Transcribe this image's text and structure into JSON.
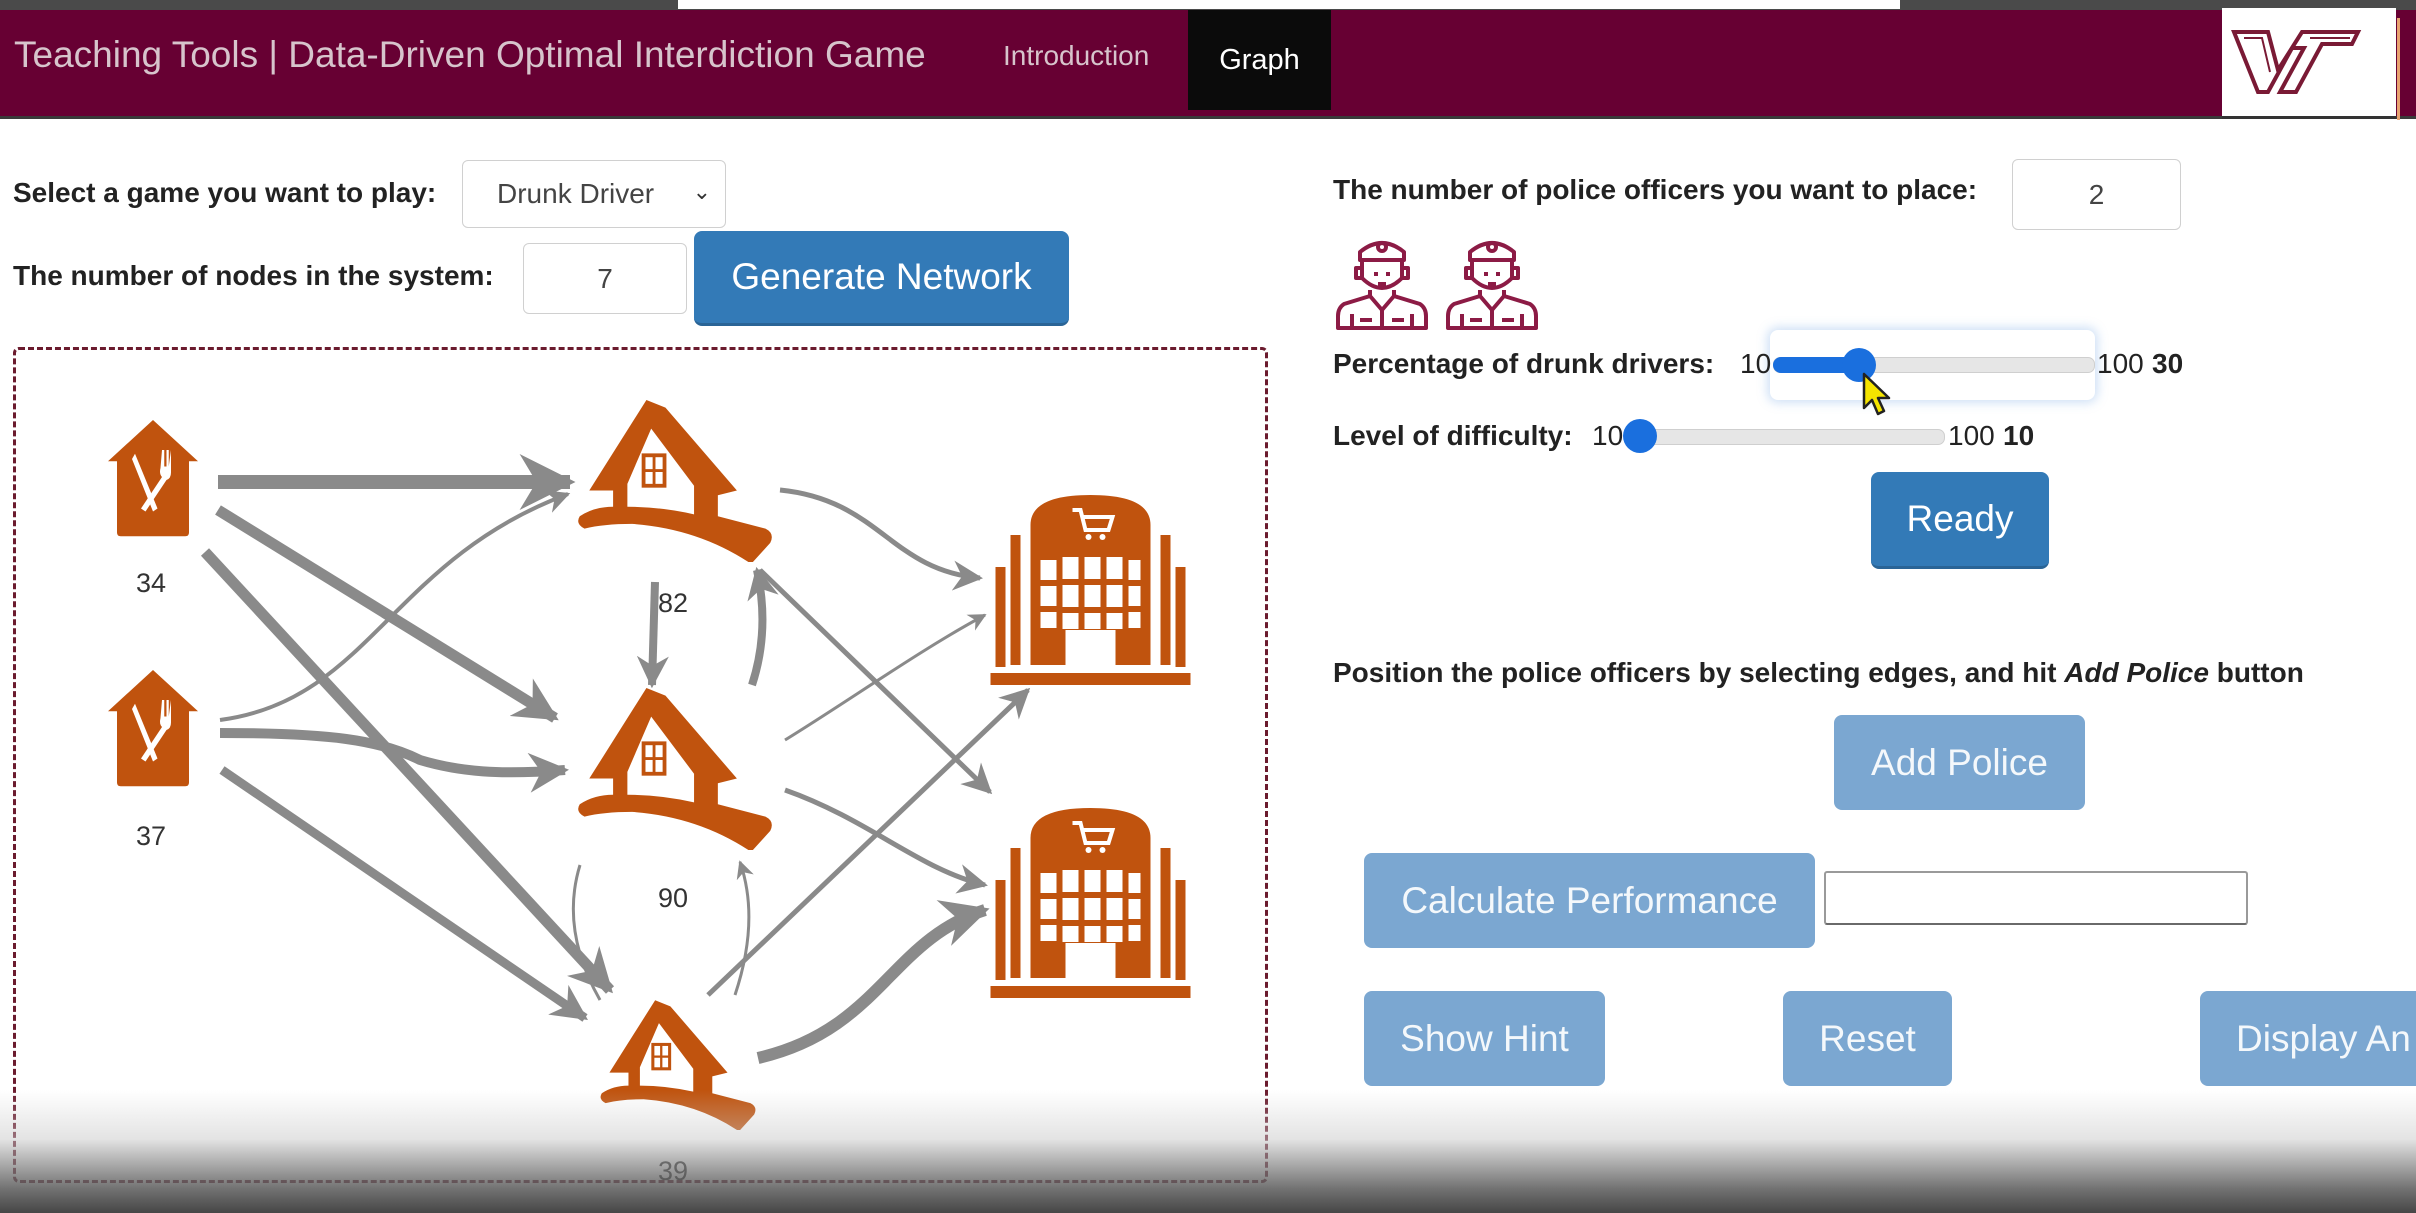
{
  "header": {
    "brand": "Teaching Tools | Data-Driven Optimal Interdiction Game",
    "nav": [
      {
        "label": "Introduction",
        "active": false
      },
      {
        "label": "Graph",
        "active": true
      }
    ],
    "logo_text": "VT"
  },
  "left": {
    "game_label": "Select a game you want to play:",
    "game_selected": "Drunk Driver",
    "nodes_label": "The number of nodes in the system:",
    "nodes_value": "7",
    "generate_button": "Generate Network"
  },
  "network": {
    "nodes": [
      {
        "id": "r1",
        "type": "restaurant",
        "label": "34"
      },
      {
        "id": "r2",
        "type": "restaurant",
        "label": "37"
      },
      {
        "id": "h1",
        "type": "house",
        "label": "82"
      },
      {
        "id": "h2",
        "type": "house",
        "label": "90"
      },
      {
        "id": "h3",
        "type": "house",
        "label": "39"
      },
      {
        "id": "s1",
        "type": "shopping-mall",
        "label": ""
      },
      {
        "id": "s2",
        "type": "shopping-mall",
        "label": ""
      }
    ],
    "edges": [
      {
        "from": "r1",
        "to": "h1",
        "weight": "heavy"
      },
      {
        "from": "r1",
        "to": "h2",
        "weight": "heavy"
      },
      {
        "from": "r1",
        "to": "h3",
        "weight": "heavy"
      },
      {
        "from": "r2",
        "to": "h1",
        "weight": "light"
      },
      {
        "from": "r2",
        "to": "h2",
        "weight": "heavy"
      },
      {
        "from": "r2",
        "to": "h3",
        "weight": "medium"
      },
      {
        "from": "h1",
        "to": "h2",
        "weight": "medium"
      },
      {
        "from": "h2",
        "to": "h1",
        "weight": "medium"
      },
      {
        "from": "h1",
        "to": "s1",
        "weight": "medium"
      },
      {
        "from": "h1",
        "to": "s2",
        "weight": "medium"
      },
      {
        "from": "h2",
        "to": "s1",
        "weight": "light"
      },
      {
        "from": "h2",
        "to": "s2",
        "weight": "medium"
      },
      {
        "from": "h2",
        "to": "h3",
        "weight": "light"
      },
      {
        "from": "h3",
        "to": "h2",
        "weight": "light"
      },
      {
        "from": "h3",
        "to": "s1",
        "weight": "medium"
      },
      {
        "from": "h3",
        "to": "s2",
        "weight": "heavy"
      }
    ],
    "colors": {
      "node": "#c0530e",
      "edge": "#8a8a8a",
      "border": "#6b1b2e"
    }
  },
  "right": {
    "police_label": "The number of police officers you want to place:",
    "police_value": "2",
    "police_icon_count": 2,
    "drunk_label": "Percentage of drunk drivers:",
    "drunk_min": "10",
    "drunk_max": "100",
    "drunk_value": "30",
    "drunk_fraction": 0.222,
    "difficulty_label": "Level of difficulty:",
    "difficulty_min": "10",
    "difficulty_max": "100",
    "difficulty_value": "10",
    "difficulty_fraction": 0.0,
    "ready_button": "Ready",
    "instruction_pre": "Position the police officers by selecting edges, and hit ",
    "instruction_em": "Add Police",
    "instruction_post": " button",
    "add_police_button": "Add Police",
    "calc_button": "Calculate Performance",
    "calc_result": "",
    "hint_button": "Show Hint",
    "reset_button": "Reset",
    "display_button": "Display An"
  },
  "colors": {
    "brand": "#670033",
    "primary": "#337ab7",
    "disabled": "#7ba7d1",
    "slider": "#1a6fde"
  }
}
